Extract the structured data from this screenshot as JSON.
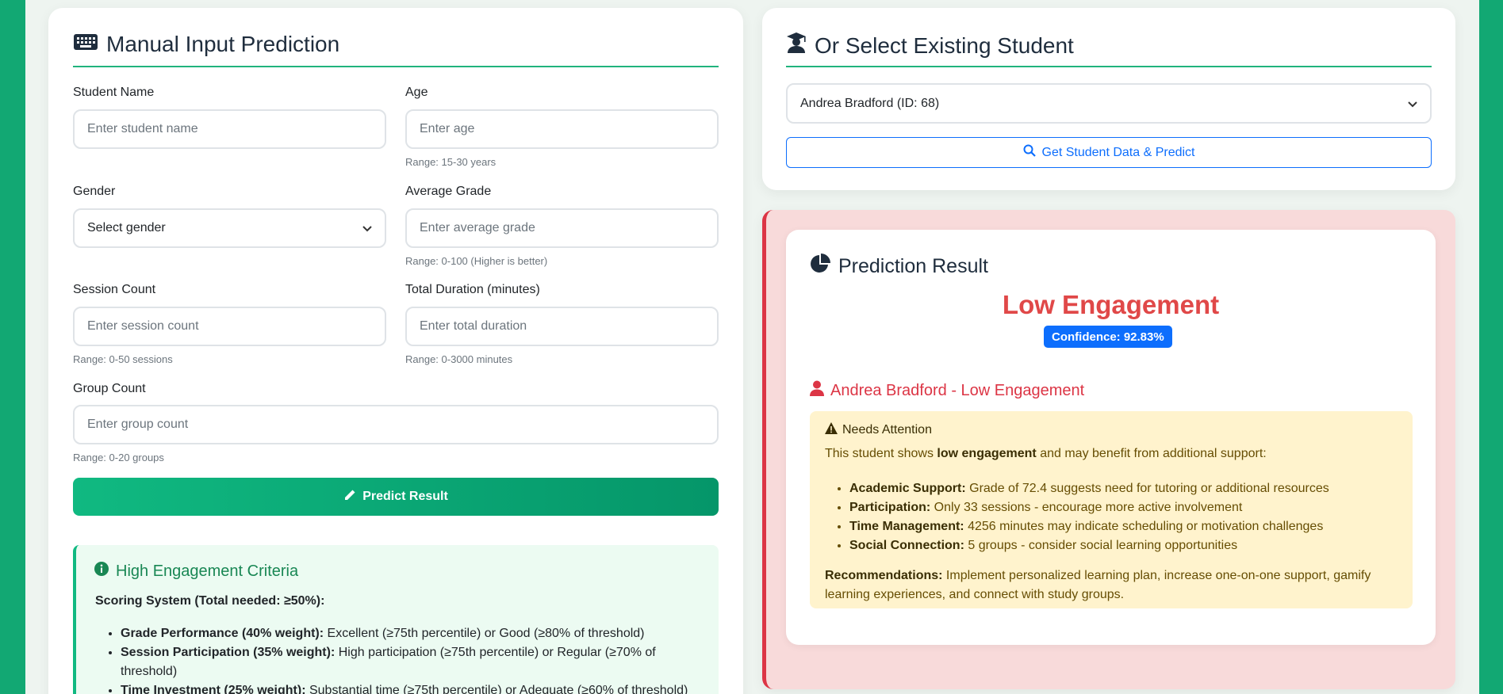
{
  "manual": {
    "title": "Manual Input Prediction",
    "fields": {
      "student_name": {
        "label": "Student Name",
        "placeholder": "Enter student name"
      },
      "age": {
        "label": "Age",
        "placeholder": "Enter age",
        "hint": "Range: 15-30 years"
      },
      "gender": {
        "label": "Gender",
        "value": "Select gender"
      },
      "average_grade": {
        "label": "Average Grade",
        "placeholder": "Enter average grade",
        "hint": "Range: 0-100 (Higher is better)"
      },
      "session_count": {
        "label": "Session Count",
        "placeholder": "Enter session count",
        "hint": "Range: 0-50 sessions"
      },
      "total_duration": {
        "label": "Total Duration (minutes)",
        "placeholder": "Enter total duration",
        "hint": "Range: 0-3000 minutes"
      },
      "group_count": {
        "label": "Group Count",
        "placeholder": "Enter group count",
        "hint": "Range: 0-20 groups"
      }
    },
    "predict_button": "Predict Result",
    "criteria": {
      "title": "High Engagement Criteria",
      "subtitle": "Scoring System (Total needed: ≥50%):",
      "items": [
        {
          "label": "Grade Performance (40% weight):",
          "text": " Excellent (≥75th percentile) or Good (≥80% of threshold)"
        },
        {
          "label": "Session Participation (35% weight):",
          "text": " High participation (≥75th percentile) or Regular (≥70% of threshold)"
        },
        {
          "label": "Time Investment (25% weight):",
          "text": " Substantial time (≥75th percentile) or Adequate (≥60% of threshold)"
        }
      ]
    }
  },
  "select": {
    "title": "Or Select Existing Student",
    "selected": "Andrea Bradford (ID: 68)",
    "button": "Get Student Data & Predict"
  },
  "result": {
    "title": "Prediction Result",
    "prediction": "Low Engagement",
    "confidence": "Confidence: 92.83%",
    "student_line": "Andrea Bradford - Low Engagement",
    "attention": {
      "heading": "Needs Attention",
      "intro_pre": "This student shows ",
      "intro_bold": "low engagement",
      "intro_post": " and may benefit from additional support:",
      "items": [
        {
          "label": "Academic Support:",
          "text": " Grade of 72.4 suggests need for tutoring or additional resources"
        },
        {
          "label": "Participation:",
          "text": " Only 33 sessions - encourage more active involvement"
        },
        {
          "label": "Time Management:",
          "text": " 4256 minutes may indicate scheduling or motivation challenges"
        },
        {
          "label": "Social Connection:",
          "text": " 5 groups - consider social learning opportunities"
        }
      ],
      "rec_label": "Recommendations:",
      "rec_text": " Implement personalized learning plan, increase one-on-one support, gamify learning experiences, and connect with study groups."
    }
  },
  "colors": {
    "accent_green": "#10b981",
    "danger": "#dc3545",
    "primary": "#0d6efd",
    "warning_bg": "#fff3cd"
  }
}
